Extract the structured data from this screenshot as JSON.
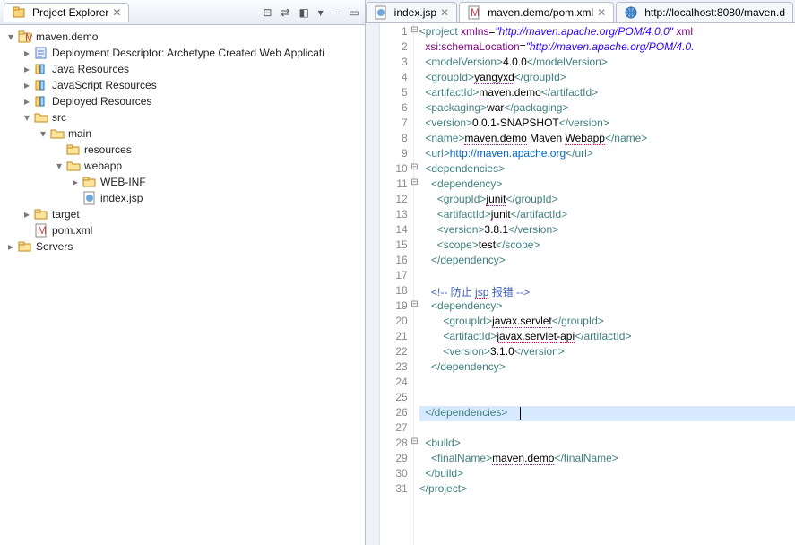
{
  "projectExplorer": {
    "title": "Project Explorer",
    "toolbarIcons": [
      "collapse-all",
      "link-editor",
      "focus",
      "view-menu",
      "minimize",
      "maximize"
    ]
  },
  "tree": [
    {
      "d": 0,
      "tw": "▾",
      "icon": "maven-proj",
      "label": "maven.demo"
    },
    {
      "d": 1,
      "tw": "▸",
      "icon": "dd",
      "label": "Deployment Descriptor: Archetype Created Web Applicati"
    },
    {
      "d": 1,
      "tw": "▸",
      "icon": "lib",
      "label": "Java Resources"
    },
    {
      "d": 1,
      "tw": "▸",
      "icon": "lib",
      "label": "JavaScript Resources"
    },
    {
      "d": 1,
      "tw": "▸",
      "icon": "lib",
      "label": "Deployed Resources"
    },
    {
      "d": 1,
      "tw": "▾",
      "icon": "folder-open",
      "label": "src"
    },
    {
      "d": 2,
      "tw": "▾",
      "icon": "folder-open",
      "label": "main"
    },
    {
      "d": 3,
      "tw": " ",
      "icon": "folder",
      "label": "resources"
    },
    {
      "d": 3,
      "tw": "▾",
      "icon": "folder-open",
      "label": "webapp"
    },
    {
      "d": 4,
      "tw": "▸",
      "icon": "folder",
      "label": "WEB-INF"
    },
    {
      "d": 4,
      "tw": " ",
      "icon": "jsp",
      "label": "index.jsp"
    },
    {
      "d": 1,
      "tw": "▸",
      "icon": "folder",
      "label": "target"
    },
    {
      "d": 1,
      "tw": " ",
      "icon": "pom",
      "label": "pom.xml"
    },
    {
      "d": 0,
      "tw": "▸",
      "icon": "folder",
      "label": "Servers"
    }
  ],
  "editorTabs": [
    {
      "icon": "jsp",
      "label": "index.jsp",
      "active": false,
      "close": true
    },
    {
      "icon": "pom",
      "label": "maven.demo/pom.xml",
      "active": true,
      "close": true
    },
    {
      "icon": "web",
      "label": "http://localhost:8080/maven.d",
      "active": false,
      "close": false
    }
  ],
  "code": {
    "lines": [
      {
        "n": 1,
        "fold": "⊟",
        "parts": [
          [
            "tag",
            "<project"
          ],
          [
            "val",
            " "
          ],
          [
            "attr",
            "xmlns"
          ],
          [
            "val",
            "="
          ],
          [
            "str",
            "\"http://maven.apache.org/POM/4.0.0\""
          ],
          [
            "val",
            " "
          ],
          [
            "attr",
            "xml"
          ]
        ]
      },
      {
        "n": 2,
        "parts": [
          [
            "val",
            "  "
          ],
          [
            "attr",
            "xsi:schemaLocation"
          ],
          [
            "val",
            "="
          ],
          [
            "str",
            "\"http://maven.apache.org/POM/4.0."
          ]
        ]
      },
      {
        "n": 3,
        "parts": [
          [
            "val",
            "  "
          ],
          [
            "tag",
            "<modelVersion>"
          ],
          [
            "val",
            "4.0.0"
          ],
          [
            "tag",
            "</modelVersion>"
          ]
        ]
      },
      {
        "n": 4,
        "parts": [
          [
            "val",
            "  "
          ],
          [
            "tag",
            "<groupId>"
          ],
          [
            "u",
            "yangyxd"
          ],
          [
            "tag",
            "</groupId>"
          ]
        ]
      },
      {
        "n": 5,
        "parts": [
          [
            "val",
            "  "
          ],
          [
            "tag",
            "<artifactId>"
          ],
          [
            "u",
            "maven.demo"
          ],
          [
            "tag",
            "</artifactId>"
          ]
        ]
      },
      {
        "n": 6,
        "parts": [
          [
            "val",
            "  "
          ],
          [
            "tag",
            "<packaging>"
          ],
          [
            "val",
            "war"
          ],
          [
            "tag",
            "</packaging>"
          ]
        ]
      },
      {
        "n": 7,
        "parts": [
          [
            "val",
            "  "
          ],
          [
            "tag",
            "<version>"
          ],
          [
            "val",
            "0.0.1-SNAPSHOT"
          ],
          [
            "tag",
            "</version>"
          ]
        ]
      },
      {
        "n": 8,
        "parts": [
          [
            "val",
            "  "
          ],
          [
            "tag",
            "<name>"
          ],
          [
            "u",
            "maven.demo"
          ],
          [
            "val",
            " Maven "
          ],
          [
            "u",
            "Webapp"
          ],
          [
            "tag",
            "</name>"
          ]
        ]
      },
      {
        "n": 9,
        "parts": [
          [
            "val",
            "  "
          ],
          [
            "tag",
            "<url>"
          ],
          [
            "link",
            "http://maven.apache.org"
          ],
          [
            "tag",
            "</url>"
          ]
        ]
      },
      {
        "n": 10,
        "fold": "⊟",
        "parts": [
          [
            "val",
            "  "
          ],
          [
            "tag",
            "<dependencies>"
          ]
        ]
      },
      {
        "n": 11,
        "fold": "⊟",
        "parts": [
          [
            "val",
            "    "
          ],
          [
            "tag",
            "<dependency>"
          ]
        ]
      },
      {
        "n": 12,
        "parts": [
          [
            "val",
            "      "
          ],
          [
            "tag",
            "<groupId>"
          ],
          [
            "u",
            "junit"
          ],
          [
            "tag",
            "</groupId>"
          ]
        ]
      },
      {
        "n": 13,
        "parts": [
          [
            "val",
            "      "
          ],
          [
            "tag",
            "<artifactId>"
          ],
          [
            "u",
            "junit"
          ],
          [
            "tag",
            "</artifactId>"
          ]
        ]
      },
      {
        "n": 14,
        "parts": [
          [
            "val",
            "      "
          ],
          [
            "tag",
            "<version>"
          ],
          [
            "val",
            "3.8.1"
          ],
          [
            "tag",
            "</version>"
          ]
        ]
      },
      {
        "n": 15,
        "parts": [
          [
            "val",
            "      "
          ],
          [
            "tag",
            "<scope>"
          ],
          [
            "val",
            "test"
          ],
          [
            "tag",
            "</scope>"
          ]
        ]
      },
      {
        "n": 16,
        "parts": [
          [
            "val",
            "    "
          ],
          [
            "tag",
            "</dependency>"
          ]
        ]
      },
      {
        "n": 17,
        "parts": [
          [
            "val",
            " "
          ]
        ]
      },
      {
        "n": 18,
        "parts": [
          [
            "val",
            "    "
          ],
          [
            "cmt",
            "<!-- 防止 "
          ],
          [
            "cmtu",
            "jsp"
          ],
          [
            "cmt",
            " 报错 -->"
          ]
        ]
      },
      {
        "n": 19,
        "fold": "⊟",
        "parts": [
          [
            "val",
            "    "
          ],
          [
            "tag",
            "<dependency>"
          ]
        ]
      },
      {
        "n": 20,
        "parts": [
          [
            "val",
            "        "
          ],
          [
            "tag",
            "<groupId>"
          ],
          [
            "u",
            "javax.servlet"
          ],
          [
            "tag",
            "</groupId>"
          ]
        ]
      },
      {
        "n": 21,
        "parts": [
          [
            "val",
            "        "
          ],
          [
            "tag",
            "<artifactId>"
          ],
          [
            "u",
            "javax.servlet"
          ],
          [
            "val",
            "-"
          ],
          [
            "u",
            "api"
          ],
          [
            "tag",
            "</artifactId>"
          ]
        ]
      },
      {
        "n": 22,
        "parts": [
          [
            "val",
            "        "
          ],
          [
            "tag",
            "<version>"
          ],
          [
            "val",
            "3.1.0"
          ],
          [
            "tag",
            "</version>"
          ]
        ]
      },
      {
        "n": 23,
        "parts": [
          [
            "val",
            "    "
          ],
          [
            "tag",
            "</dependency>"
          ]
        ]
      },
      {
        "n": 24,
        "parts": [
          [
            "val",
            " "
          ]
        ]
      },
      {
        "n": 25,
        "parts": [
          [
            "val",
            " "
          ]
        ]
      },
      {
        "n": 26,
        "hl": true,
        "cursor": true,
        "parts": [
          [
            "val",
            "  "
          ],
          [
            "tag",
            "</dependencies>"
          ],
          [
            "val",
            "    "
          ]
        ]
      },
      {
        "n": 27,
        "parts": [
          [
            "val",
            " "
          ]
        ]
      },
      {
        "n": 28,
        "fold": "⊟",
        "parts": [
          [
            "val",
            "  "
          ],
          [
            "tag",
            "<build>"
          ]
        ]
      },
      {
        "n": 29,
        "parts": [
          [
            "val",
            "    "
          ],
          [
            "tag",
            "<finalName>"
          ],
          [
            "u",
            "maven.demo"
          ],
          [
            "tag",
            "</finalName>"
          ]
        ]
      },
      {
        "n": 30,
        "parts": [
          [
            "val",
            "  "
          ],
          [
            "tag",
            "</build>"
          ]
        ]
      },
      {
        "n": 31,
        "parts": [
          [
            "tag",
            "</project>"
          ]
        ]
      }
    ]
  }
}
